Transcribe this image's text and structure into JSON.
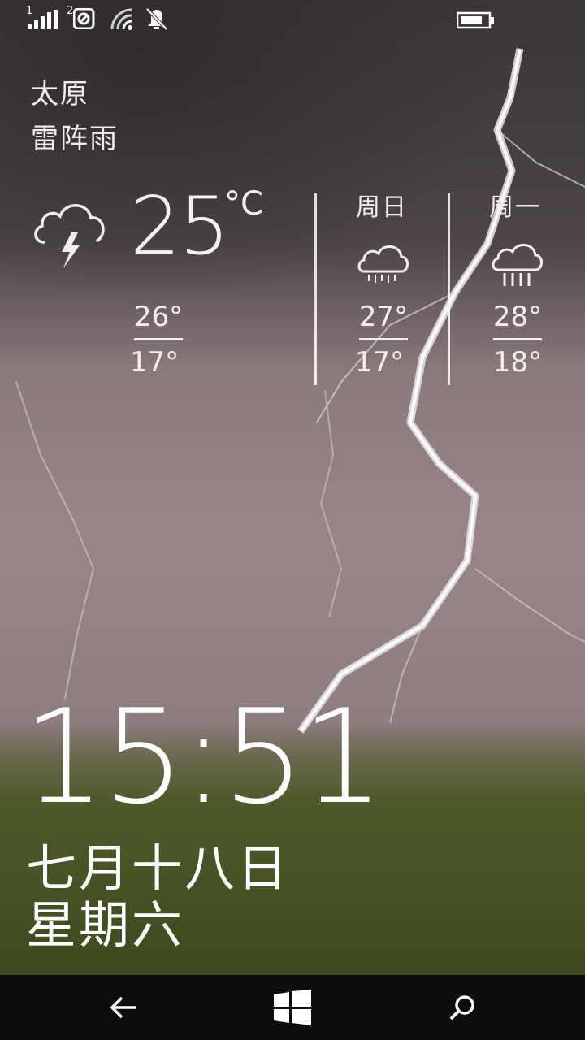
{
  "status_bar": {
    "sim1_label": "1",
    "sim2_label": "2",
    "icons": [
      "signal-icon",
      "sim2-signal-icon",
      "wifi-icon",
      "quiet-hours-bell-icon",
      "battery-icon"
    ]
  },
  "weather": {
    "city": "太原",
    "condition": "雷阵雨",
    "current_temp": "25",
    "unit": "°C",
    "today": {
      "high": "26°",
      "low": "17°",
      "icon": "thunderstorm-icon"
    },
    "forecast": [
      {
        "day": "周日",
        "high": "27°",
        "low": "17°",
        "icon": "rain-icon"
      },
      {
        "day": "周一",
        "high": "28°",
        "low": "18°",
        "icon": "rain-icon"
      }
    ]
  },
  "lock": {
    "time": "15:51",
    "date": "七月十八日",
    "weekday": "星期六"
  },
  "nav": {
    "icons": [
      "back-icon",
      "windows-start-icon",
      "search-icon"
    ]
  },
  "colors": {
    "text": "#ffffff",
    "navbar": "#0d0d0d",
    "sky_dark": "#3f3b3e",
    "grass": "#4f5a28"
  }
}
